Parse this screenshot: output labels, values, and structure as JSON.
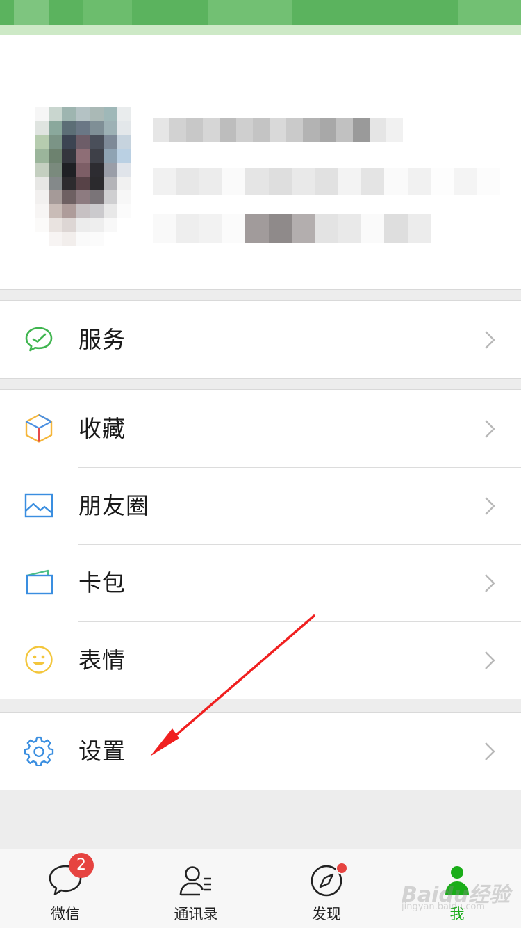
{
  "menu_groups": [
    {
      "items": [
        {
          "label": "服务",
          "icon": "service-icon"
        }
      ]
    },
    {
      "items": [
        {
          "label": "收藏",
          "icon": "favorites-cube-icon"
        },
        {
          "label": "朋友圈",
          "icon": "moments-image-icon"
        },
        {
          "label": "卡包",
          "icon": "card-wallet-icon"
        },
        {
          "label": "表情",
          "icon": "smiley-icon"
        }
      ]
    },
    {
      "items": [
        {
          "label": "设置",
          "icon": "gear-icon"
        }
      ]
    }
  ],
  "tabs": [
    {
      "label": "微信",
      "icon": "chat-bubble-icon",
      "badge": "2"
    },
    {
      "label": "通讯录",
      "icon": "contacts-icon"
    },
    {
      "label": "发现",
      "icon": "compass-icon"
    },
    {
      "label": "我",
      "icon": "person-icon",
      "active": true
    }
  ],
  "watermark": {
    "brand": "Baidu经验",
    "url": "jingyan.baidu.com"
  },
  "colors": {
    "brand_green": "#1aad19",
    "status_green": "#5bb35e",
    "badge_red": "#e64340",
    "arrow_red": "#f02020"
  }
}
